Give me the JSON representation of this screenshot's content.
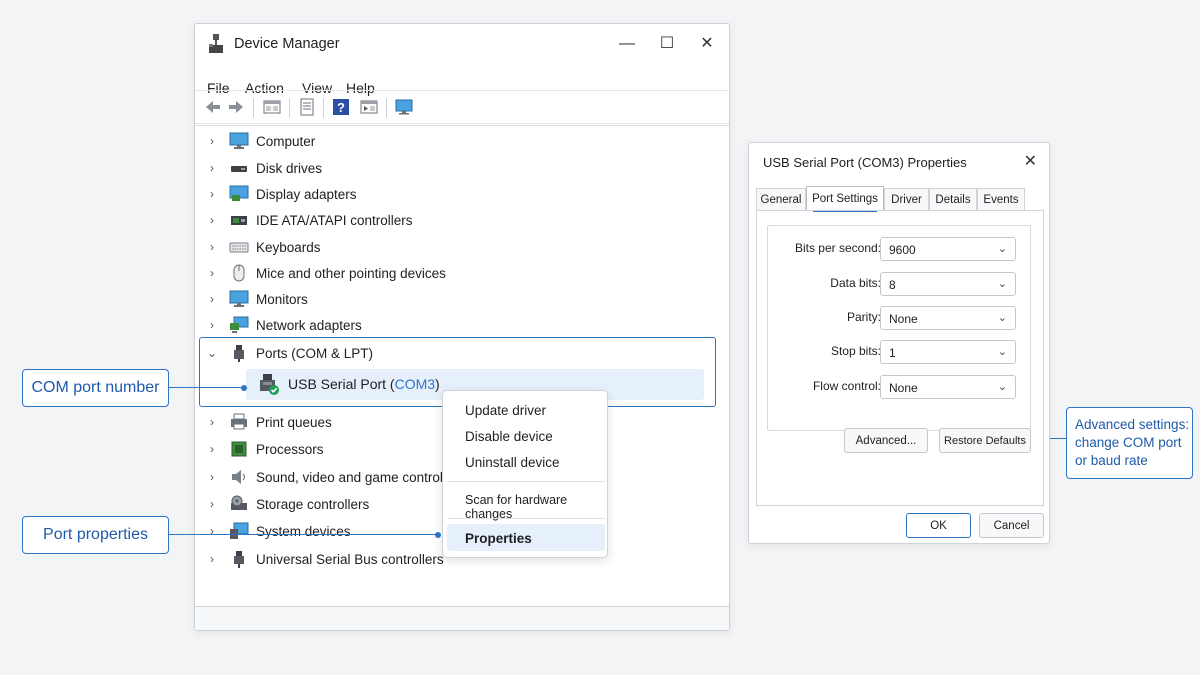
{
  "window": {
    "title": "Device Manager",
    "menu": [
      "File",
      "Action",
      "View",
      "Help"
    ],
    "tree": [
      {
        "label": "Computer",
        "icon": "computer-icon"
      },
      {
        "label": "Disk drives",
        "icon": "disk-drive-icon"
      },
      {
        "label": "Display adapters",
        "icon": "display-adapter-icon"
      },
      {
        "label": "IDE ATA/ATAPI controllers",
        "icon": "ide-controller-icon"
      },
      {
        "label": "Keyboards",
        "icon": "keyboard-icon"
      },
      {
        "label": "Mice and other pointing devices",
        "icon": "mouse-icon"
      },
      {
        "label": "Monitors",
        "icon": "monitor-icon"
      },
      {
        "label": "Network adapters",
        "icon": "network-adapter-icon"
      },
      {
        "label": "Ports (COM & LPT)",
        "icon": "port-icon",
        "expanded": true
      },
      {
        "label": "Print queues",
        "icon": "printer-icon"
      },
      {
        "label": "Processors",
        "icon": "processor-icon"
      },
      {
        "label": "Sound, video and game controllers",
        "icon": "speaker-icon"
      },
      {
        "label": "Storage controllers",
        "icon": "storage-controller-icon"
      },
      {
        "label": "System devices",
        "icon": "system-device-icon"
      },
      {
        "label": "Universal Serial Bus controllers",
        "icon": "usb-icon"
      }
    ],
    "usb_device": {
      "label_prefix": "USB Serial Port (",
      "com": "COM3",
      "label_suffix": ")"
    }
  },
  "context_menu": {
    "items": [
      "Update driver",
      "Disable device",
      "Uninstall device",
      "Scan for hardware changes",
      "Properties"
    ],
    "selected": "Properties"
  },
  "callouts": {
    "com_port": "COM port number",
    "port_props": "Port properties",
    "advanced": [
      "Advanced settings:",
      "change COM port",
      "or baud rate"
    ]
  },
  "dialog": {
    "title": "USB Serial Port (COM3) Properties",
    "tabs": [
      "General",
      "Port Settings",
      "Driver",
      "Details",
      "Events"
    ],
    "active_tab": "Port Settings",
    "fields": [
      {
        "label": "Bits per second:",
        "value": "9600"
      },
      {
        "label": "Data bits:",
        "value": "8"
      },
      {
        "label": "Parity:",
        "value": "None"
      },
      {
        "label": "Stop bits:",
        "value": "1"
      },
      {
        "label": "Flow control:",
        "value": "None"
      }
    ],
    "advanced_button": "Advanced...",
    "restore_button": "Restore Defaults",
    "ok_button": "OK",
    "cancel_button": "Cancel"
  },
  "colors": {
    "accent": "#2e74c7",
    "callout_text": "#1e5aa8",
    "selection": "#e6f0fa",
    "status_ok": "#1f9d55"
  }
}
